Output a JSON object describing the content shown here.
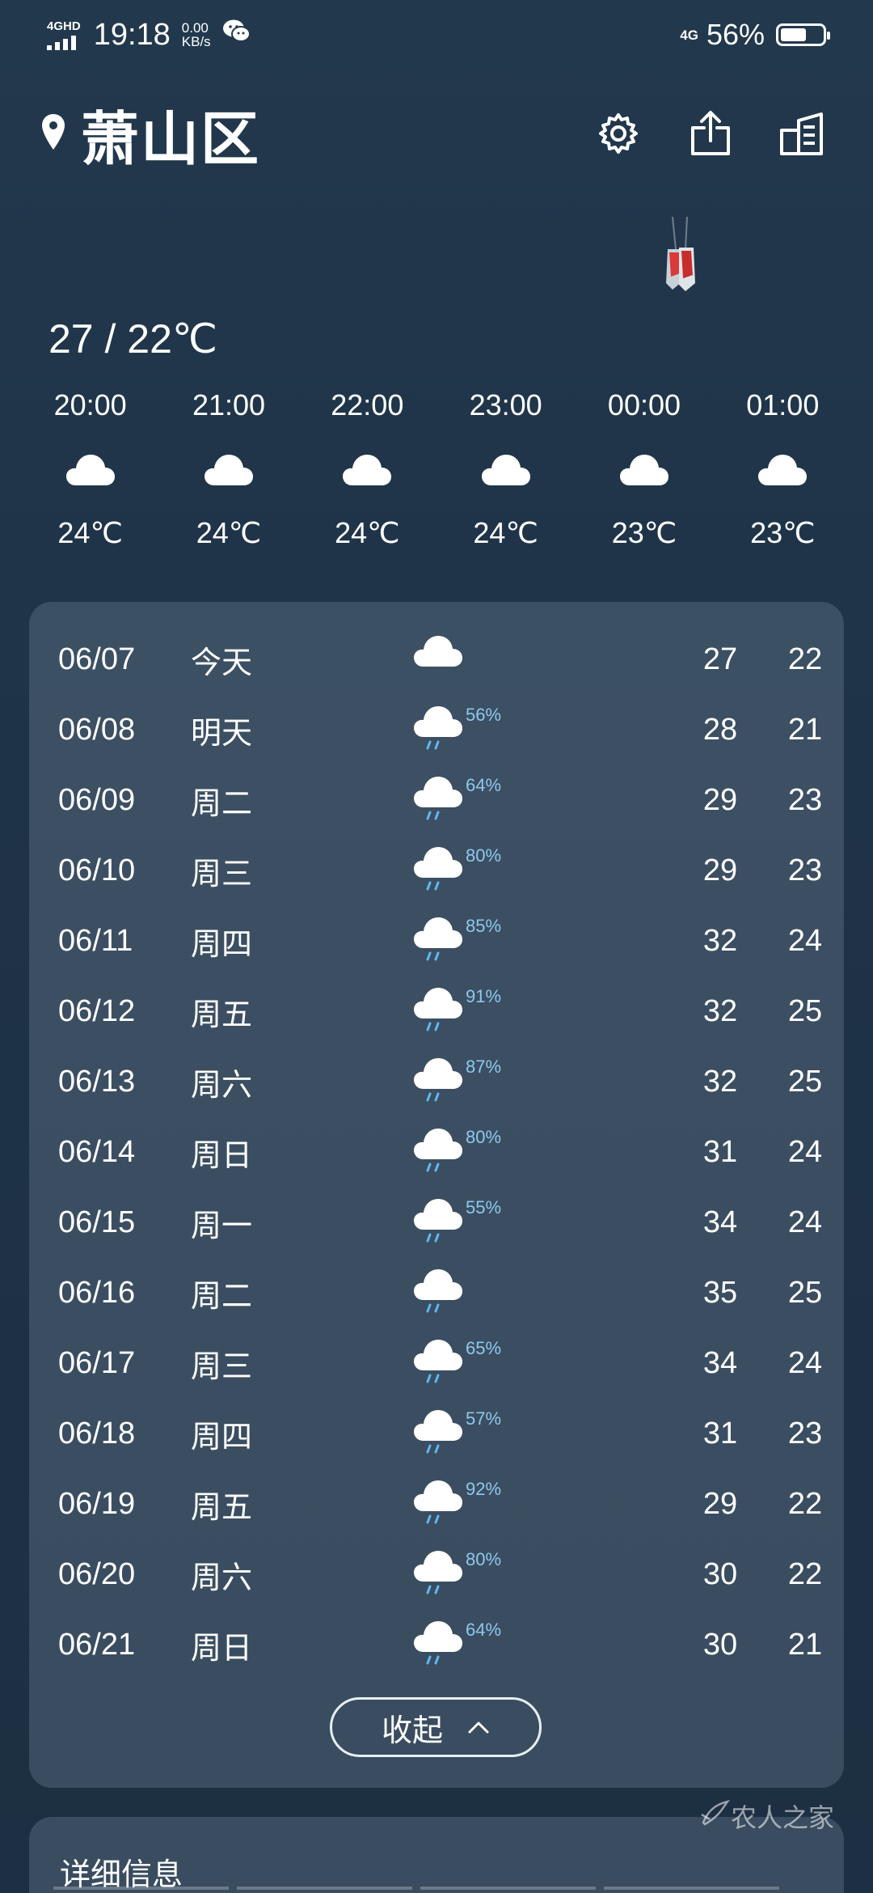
{
  "status_bar": {
    "network_type": "4GHD",
    "time": "19:18",
    "speed_value": "0.00",
    "speed_unit": "KB/s",
    "cell_label": "4G",
    "battery_percent": "56%",
    "battery_level": 0.56
  },
  "header": {
    "location": "萧山区",
    "icons": [
      "location-pin-icon",
      "settings-icon",
      "share-icon",
      "city-list-icon"
    ]
  },
  "today_range": "27 / 22℃",
  "hourly": [
    {
      "time": "20:00",
      "icon": "cloudy-icon",
      "temp": "24℃"
    },
    {
      "time": "21:00",
      "icon": "cloudy-icon",
      "temp": "24℃"
    },
    {
      "time": "22:00",
      "icon": "cloudy-icon",
      "temp": "24℃"
    },
    {
      "time": "23:00",
      "icon": "cloudy-icon",
      "temp": "24℃"
    },
    {
      "time": "00:00",
      "icon": "cloudy-icon",
      "temp": "23℃"
    },
    {
      "time": "01:00",
      "icon": "cloudy-icon",
      "temp": "23℃"
    }
  ],
  "daily": [
    {
      "date": "06/07",
      "day": "今天",
      "icon": "cloudy-icon",
      "pop": "",
      "high": "27",
      "low": "22"
    },
    {
      "date": "06/08",
      "day": "明天",
      "icon": "rain-icon",
      "pop": "56%",
      "high": "28",
      "low": "21"
    },
    {
      "date": "06/09",
      "day": "周二",
      "icon": "rain-icon",
      "pop": "64%",
      "high": "29",
      "low": "23"
    },
    {
      "date": "06/10",
      "day": "周三",
      "icon": "rain-icon",
      "pop": "80%",
      "high": "29",
      "low": "23"
    },
    {
      "date": "06/11",
      "day": "周四",
      "icon": "rain-icon",
      "pop": "85%",
      "high": "32",
      "low": "24"
    },
    {
      "date": "06/12",
      "day": "周五",
      "icon": "rain-icon",
      "pop": "91%",
      "high": "32",
      "low": "25"
    },
    {
      "date": "06/13",
      "day": "周六",
      "icon": "rain-icon",
      "pop": "87%",
      "high": "32",
      "low": "25"
    },
    {
      "date": "06/14",
      "day": "周日",
      "icon": "rain-icon",
      "pop": "80%",
      "high": "31",
      "low": "24"
    },
    {
      "date": "06/15",
      "day": "周一",
      "icon": "rain-icon",
      "pop": "55%",
      "high": "34",
      "low": "24"
    },
    {
      "date": "06/16",
      "day": "周二",
      "icon": "rain-icon",
      "pop": "",
      "high": "35",
      "low": "25"
    },
    {
      "date": "06/17",
      "day": "周三",
      "icon": "rain-icon",
      "pop": "65%",
      "high": "34",
      "low": "24"
    },
    {
      "date": "06/18",
      "day": "周四",
      "icon": "rain-icon",
      "pop": "57%",
      "high": "31",
      "low": "23"
    },
    {
      "date": "06/19",
      "day": "周五",
      "icon": "rain-icon",
      "pop": "92%",
      "high": "29",
      "low": "22"
    },
    {
      "date": "06/20",
      "day": "周六",
      "icon": "rain-icon",
      "pop": "80%",
      "high": "30",
      "low": "22"
    },
    {
      "date": "06/21",
      "day": "周日",
      "icon": "rain-icon",
      "pop": "64%",
      "high": "30",
      "low": "21"
    }
  ],
  "collapse_label": "收起",
  "details_title": "详细信息",
  "watermark": "农人之家",
  "colors": {
    "background": "#1f3347",
    "card": "#4a5e70",
    "precip_text": "#8ec8ee",
    "rain_drop": "#5fb8f0"
  }
}
